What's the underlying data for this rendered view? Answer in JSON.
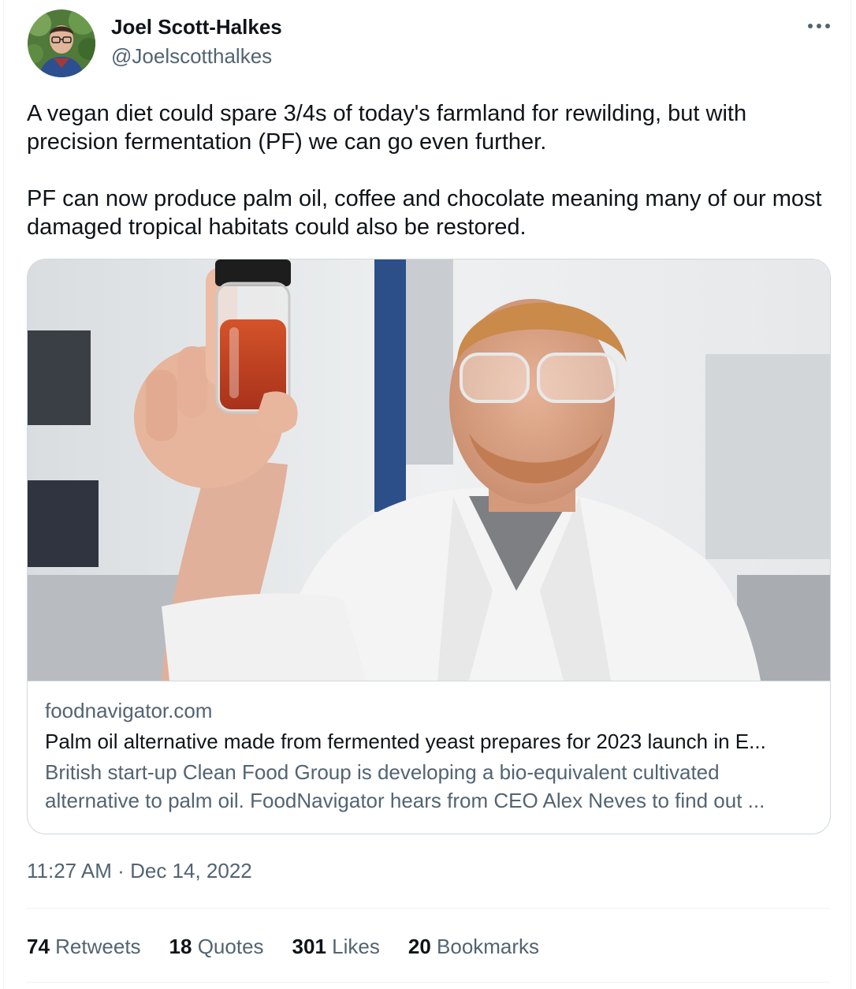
{
  "author": {
    "display_name": "Joel Scott-Halkes",
    "handle": "@Joelscotthalkes"
  },
  "tweet": {
    "paragraphs": [
      "A vegan diet could spare 3/4s of today's farmland for rewilding, but with precision fermentation (PF) we can go even further.",
      "PF can now produce palm oil, coffee and chocolate meaning many of our most damaged tropical habitats could also be restored."
    ]
  },
  "card": {
    "domain": "foodnavigator.com",
    "title": "Palm oil alternative made from fermented yeast prepares for 2023 launch in E...",
    "description": "British start-up Clean Food Group is developing a bio-equivalent cultivated alternative to palm oil. FoodNavigator hears from CEO Alex Neves to find out ..."
  },
  "timestamp": {
    "time": "11:27 AM",
    "separator": "·",
    "date": "Dec 14, 2022"
  },
  "stats": [
    {
      "count": "74",
      "label": "Retweets"
    },
    {
      "count": "18",
      "label": "Quotes"
    },
    {
      "count": "301",
      "label": "Likes"
    },
    {
      "count": "20",
      "label": "Bookmarks"
    }
  ],
  "icons": {
    "more": "more-horizontal-icon"
  },
  "colors": {
    "text_primary": "#0f1419",
    "text_secondary": "#536471",
    "border": "#cfd9de",
    "divider": "#eff3f4"
  }
}
